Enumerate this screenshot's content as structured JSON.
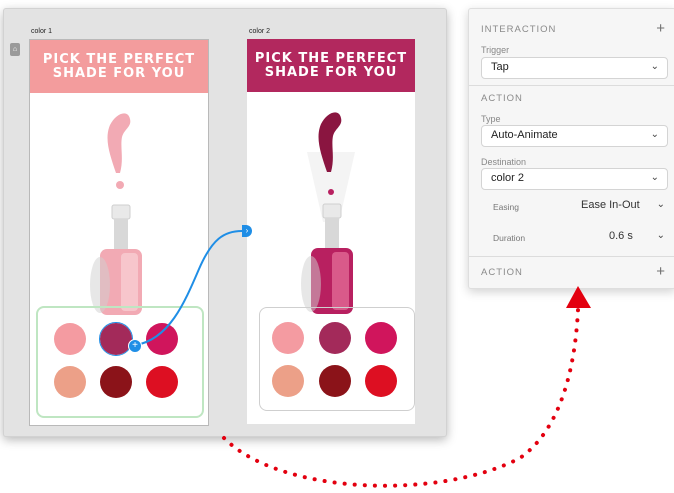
{
  "canvas": {
    "artboards": [
      {
        "label": "color 1",
        "banner": "PICK THE PERFECT\nSHADE FOR YOU",
        "banner_color": "#f39c9d",
        "polish_color": "#f2aab4"
      },
      {
        "label": "color 2",
        "banner": "PICK THE PERFECT\nSHADE FOR YOU",
        "banner_color": "#b2285e",
        "polish_color": "#b82060"
      }
    ],
    "swatch_colors": [
      "#f49ba1",
      "#a32a5a",
      "#d0155c",
      "#eca088",
      "#8b1319",
      "#dd0f22"
    ]
  },
  "panel": {
    "interaction_header": "INTERACTION",
    "trigger_label": "Trigger",
    "trigger_value": "Tap",
    "action_header": "ACTION",
    "type_label": "Type",
    "type_value": "Auto-Animate",
    "destination_label": "Destination",
    "destination_value": "color 2",
    "easing_label": "Easing",
    "easing_value": "Ease In-Out",
    "duration_label": "Duration",
    "duration_value": "0.6 s",
    "action2_header": "ACTION"
  },
  "colors": {
    "wire": "#1f8ee6",
    "arrow": "#e3000f"
  }
}
